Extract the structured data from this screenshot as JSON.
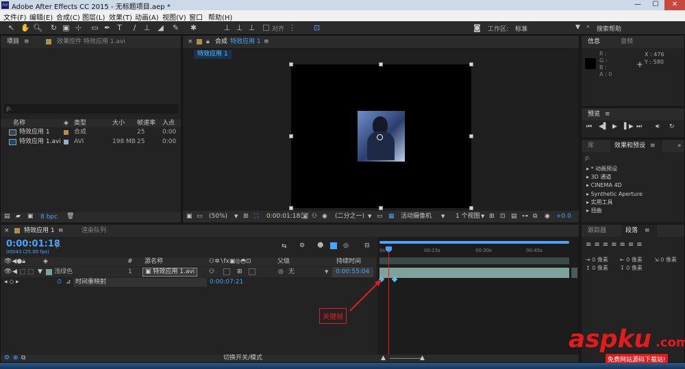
{
  "app": {
    "title": "Adobe After Effects CC 2015 - 无标题项目.aep *",
    "logo": "Ae"
  },
  "window_controls": {
    "min": "—",
    "max": "☐",
    "close": "✕"
  },
  "menu": [
    "文件(F)",
    "编辑(E)",
    "合成(C)",
    "图层(L)",
    "效果(T)",
    "动画(A)",
    "视图(V)",
    "窗口",
    "帮助(H)"
  ],
  "toolbar": {
    "align_label": "对齐",
    "workspace_label": "工作区:",
    "workspace_value": "标准",
    "search_help": "搜索帮助"
  },
  "project_panel": {
    "tab": "项目",
    "effects_tab": "效果控件 特效应用 1.avi",
    "search_placeholder": "ρ.",
    "columns": [
      "名称",
      "类型",
      "大小",
      "帧速率",
      "入点"
    ],
    "items": [
      {
        "name": "特效应用 1",
        "type": "合成",
        "size": "",
        "fps": "25",
        "in": "0:00"
      },
      {
        "name": "特效应用 1.avi",
        "type": "AVI",
        "size": "198 MB",
        "fps": "25",
        "in": "0:00"
      }
    ],
    "bpc": "8 bpc"
  },
  "comp_panel": {
    "tab": "合成",
    "comp_name": "特效应用 1",
    "sub_tab": "特效应用 1",
    "zoom": "(50%)",
    "timecode": "0:00:01:18",
    "resolution": "(二分之一)",
    "camera": "活动摄像机",
    "views": "1 个视图",
    "exposure": "+0.0"
  },
  "info_panel": {
    "tab": "信息",
    "audio_tab": "音频",
    "r": "R :",
    "g": "G :",
    "b": "B :",
    "a": "A : 0",
    "x": "X : 476",
    "y": "Y : 580"
  },
  "preview_panel": {
    "tab": "预览"
  },
  "effects_panel": {
    "lib_tab": "库",
    "tab": "效果和预设",
    "search_placeholder": "ρ.",
    "items": [
      "* 动画预设",
      "3D 通道",
      "CINEMA 4D",
      "Synthetic Aperture",
      "实用工具",
      "扭曲"
    ]
  },
  "timeline": {
    "tab": "特效应用 1",
    "render_tab": "渲染队列",
    "timecode": "0:00:01:18",
    "frames": "00043 (25.00 fps)",
    "search_placeholder": "ρ.",
    "columns": {
      "num": "#",
      "source": "源名称",
      "parent": "父级",
      "duration": "持续时间"
    },
    "layer": {
      "color_label": "浅绿色",
      "num": "1",
      "source": "特效应用 1.avi",
      "parent": "无",
      "duration": "0:00:55:04"
    },
    "sublayer": {
      "name": "时间重映射",
      "value": "0:00:07:21"
    },
    "ruler": [
      "0s",
      "00:15s",
      "00:30s",
      "00:45s"
    ],
    "toggle_label": "切换开关/模式",
    "annotation": "关键帧"
  },
  "right_bottom": {
    "tab1": "跟踪器",
    "tab2": "段落",
    "px": "0 像素"
  },
  "watermark": {
    "main": "aspku",
    "tld": ".com",
    "sub": "免费网站源码下载站!"
  },
  "colors": {
    "accent": "#4aa3ff",
    "keyframe": "#59c3e6",
    "annotation": "#e02020",
    "layer_bar": "#7fa39c"
  }
}
